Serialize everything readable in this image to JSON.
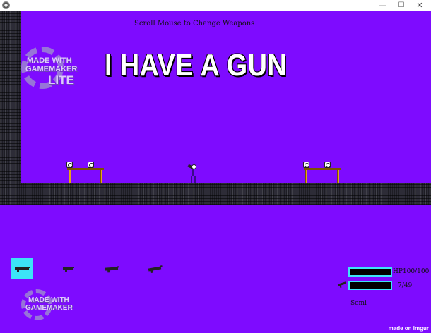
{
  "window": {
    "minimize_glyph": "—",
    "maximize_glyph": "☐",
    "close_glyph": "✕",
    "app_icon": "gear-icon"
  },
  "game": {
    "background_color": "#7e0bff",
    "hint": "Scroll Mouse to Change Weapons",
    "title": "I HAVE A GUN",
    "watermark_top": {
      "line1": "MADE WITH",
      "line2": "GAMEMAKER",
      "line3": "LITE"
    },
    "watermark_bottom": {
      "line1": "MADE WITH",
      "line2": "GAMEMAKER"
    },
    "weapons": [
      {
        "name": "slot-1",
        "icon": "gun-icon",
        "selected": true
      },
      {
        "name": "slot-2",
        "icon": "pistol-icon",
        "selected": false
      },
      {
        "name": "slot-3",
        "icon": "shotgun-icon",
        "selected": false
      },
      {
        "name": "slot-4",
        "icon": "rifle-icon",
        "selected": false
      }
    ],
    "hud": {
      "hp_label": "HP100/100",
      "hp_current": 100,
      "hp_max": 100,
      "ammo_label": "7/49",
      "ammo_current": 7,
      "ammo_reserve": 49,
      "weapon_name": "Semi",
      "accent_color": "#3ce4f7"
    },
    "credit": "made on imgur"
  }
}
